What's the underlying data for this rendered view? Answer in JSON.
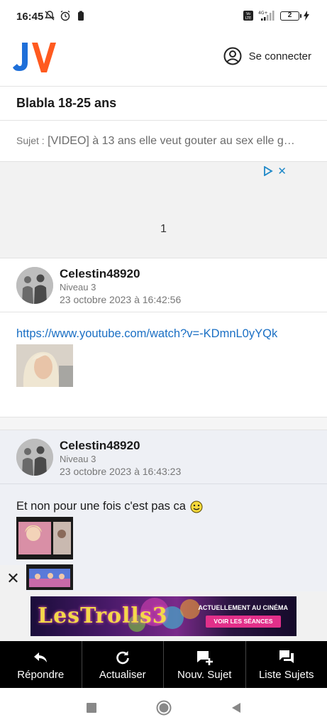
{
  "status_bar": {
    "time": "16:45",
    "battery": "2",
    "network": "4G+",
    "volte": "Vo LTE"
  },
  "header": {
    "logo_text": "JV",
    "login_label": "Se connecter"
  },
  "forum": {
    "title": "Blabla 18-25 ans",
    "subject_prefix": "Sujet :",
    "subject": "[VIDEO] à 13 ans elle veut gouter au sex elle g…"
  },
  "ad_top": {
    "counter": "1"
  },
  "posts": [
    {
      "author": "Celestin48920",
      "level": "Niveau 3",
      "date": "23 octobre 2023 à 16:42:56",
      "link": "https://www.youtube.com/watch?v=-KDmnL0yYQk"
    },
    {
      "author": "Celestin48920",
      "level": "Niveau 3",
      "date": "23 octobre 2023 à 16:43:23",
      "text": "Et non pour une fois c'est pas ca"
    }
  ],
  "ad_bottom": {
    "title": "LesTrolls3",
    "subtitle": "ACTUELLEMENT AU CINÉMA",
    "cta": "VOIR LES SÉANCES"
  },
  "actions": [
    {
      "label": "Répondre",
      "icon": "reply-icon"
    },
    {
      "label": "Actualiser",
      "icon": "refresh-icon"
    },
    {
      "label": "Nouv. Sujet",
      "icon": "new-topic-icon"
    },
    {
      "label": "Liste Sujets",
      "icon": "topic-list-icon"
    }
  ],
  "colors": {
    "link": "#1a6fc4",
    "logo_blue": "#1e6fd9",
    "logo_orange": "#ff5a1f",
    "action_bar": "#000000",
    "post_alt_bg": "#eef0f5"
  }
}
